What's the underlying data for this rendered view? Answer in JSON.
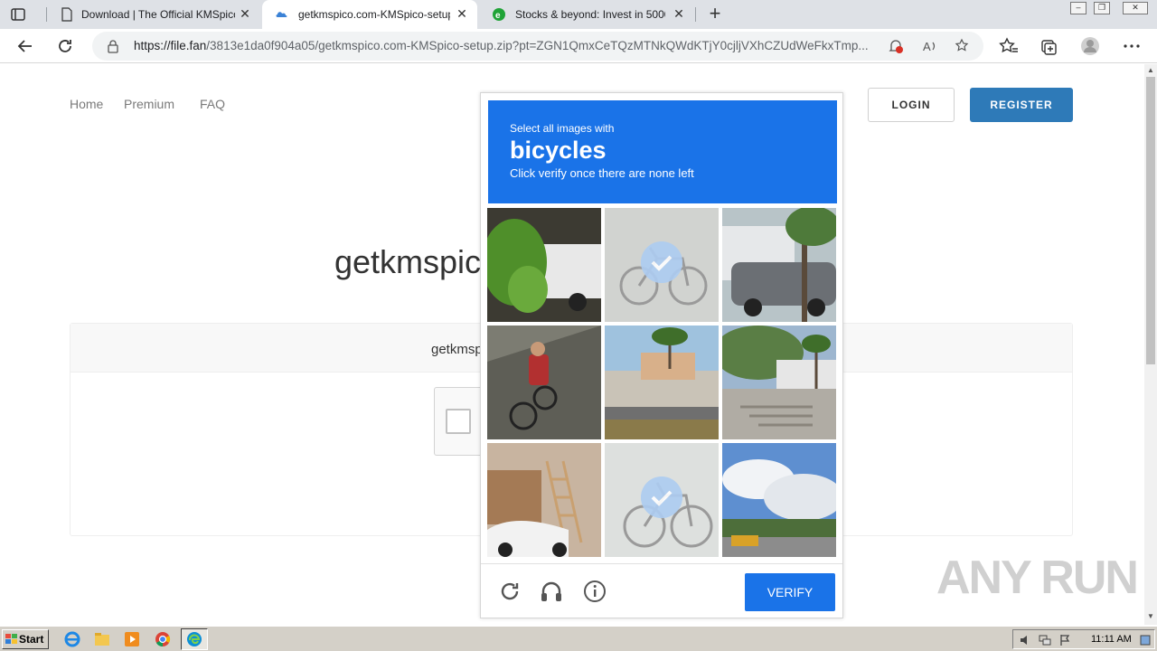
{
  "browser": {
    "tabs": [
      {
        "title": "Download | The Official KMSpico",
        "icon": "page-icon",
        "active": false
      },
      {
        "title": "getkmspico.com-KMSpico-setup",
        "icon": "cloud-icon",
        "active": true
      },
      {
        "title": "Stocks & beyond: Invest in 5000",
        "icon": "etoro-icon",
        "active": false
      }
    ],
    "url_domain": "https://file.fan",
    "url_path": "/3813e1da0f904a05/getkmspico.com-KMSpico-setup.zip?pt=ZGN1QmxCeTQzMTNkQWdKTjY0cjljVXhCZUdWeFkxTmp..."
  },
  "site": {
    "nav": [
      "Home",
      "Premium",
      "FAQ"
    ],
    "login_label": "LOGIN",
    "register_label": "REGISTER",
    "page_title": "getkmspico",
    "card_title": "getkmsp"
  },
  "captcha": {
    "instruction": "Select all images with",
    "target": "bicycles",
    "hint": "Click verify once there are none left",
    "verify_label": "VERIFY",
    "tiles": [
      {
        "subject": "car-with-plant",
        "selected": false
      },
      {
        "subject": "bicycle",
        "selected": true
      },
      {
        "subject": "van-and-car",
        "selected": false
      },
      {
        "subject": "cyclist-on-road",
        "selected": false
      },
      {
        "subject": "building-with-palm",
        "selected": false
      },
      {
        "subject": "plaza-with-stairs",
        "selected": false
      },
      {
        "subject": "car-by-shed",
        "selected": false
      },
      {
        "subject": "bicycle-parked",
        "selected": true
      },
      {
        "subject": "road-with-bus",
        "selected": false
      }
    ]
  },
  "watermark": "ANY RUN",
  "taskbar": {
    "start_label": "Start",
    "apps": [
      "ie-icon",
      "explorer-icon",
      "media-player-icon",
      "chrome-icon",
      "edge-icon"
    ],
    "clock": "11:11 AM"
  },
  "colors": {
    "captcha_blue": "#1a73e8",
    "register_blue": "#2e7ab8"
  }
}
